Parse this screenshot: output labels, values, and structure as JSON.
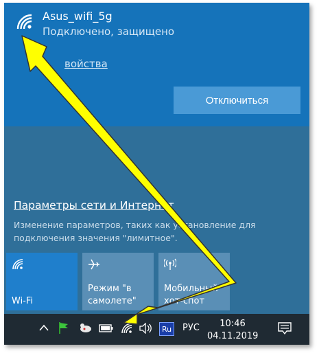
{
  "network": {
    "name": "Asus_wifi_5g",
    "status": "Подключено, защищено",
    "properties_link": "войства",
    "disconnect_label": "Отключиться"
  },
  "settings": {
    "title": "Параметры сети и Интернет",
    "description": "Изменение параметров, таких как установление для подключения значения \"лимитное\"."
  },
  "tiles": [
    {
      "label": "Wi-Fi",
      "icon": "wifi-icon",
      "active": true
    },
    {
      "label": "Режим \"в самолете\"",
      "icon": "airplane-icon",
      "active": false
    },
    {
      "label": "Мобильный хот-спот",
      "icon": "hotspot-icon",
      "active": false
    }
  ],
  "taskbar": {
    "lang_badge": "Ru",
    "lang": "РУС",
    "time": "10:46",
    "date": "04.11.2019"
  },
  "colors": {
    "header": "#1573ba",
    "panel": "#2f6f99",
    "button": "#4a9ad6",
    "tile_active": "#1f7fcc",
    "tile_inactive": "#5a8fb6",
    "taskbar": "#1f2a33",
    "arrow": "#ffff00"
  }
}
